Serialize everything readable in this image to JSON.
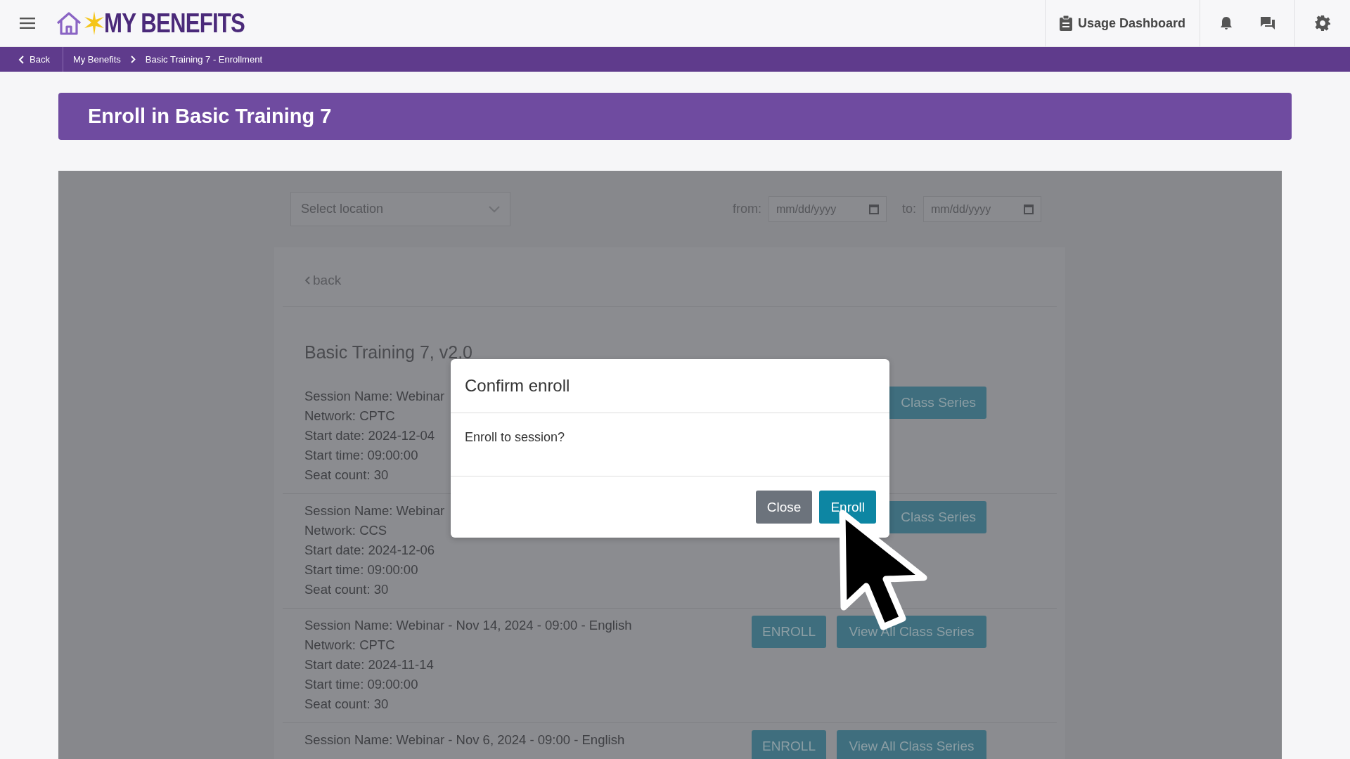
{
  "header": {
    "logo_text": "MY BENEFITS",
    "usage_button": "Usage Dashboard"
  },
  "breadcrumb": {
    "back": "Back",
    "items": [
      "My Benefits",
      "Basic Training 7 - Enrollment"
    ]
  },
  "page_title": "Enroll in Basic Training 7",
  "filters": {
    "location_placeholder": "Select location",
    "from_label": "from:",
    "from_placeholder": "mm/dd/yyyy",
    "to_label": "to:",
    "to_placeholder": "mm/dd/yyyy"
  },
  "back_link": "back",
  "course_title": "Basic Training 7, v2.0",
  "sessions": [
    {
      "lines": [
        "Session Name: Webinar",
        "Network: CPTC",
        "Start date: 2024-12-04",
        "Start time: 09:00:00",
        "Seat count: 30"
      ],
      "view_button": "Class Series"
    },
    {
      "lines": [
        "Session Name: Webinar",
        "Network: CCS",
        "Start date: 2024-12-06",
        "Start time: 09:00:00",
        "Seat count: 30"
      ],
      "view_button": "Class Series"
    },
    {
      "lines": [
        "Session Name: Webinar - Nov 14, 2024 - 09:00 - English",
        "Network: CPTC",
        "Start date: 2024-11-14",
        "Start time: 09:00:00",
        "Seat count: 30"
      ],
      "enroll_button": "ENROLL",
      "view_button": "View All Class Series"
    },
    {
      "lines": [
        "Session Name: Webinar - Nov 6, 2024 - 09:00 - English"
      ],
      "enroll_button": "ENROLL",
      "view_button": "View All Class Series"
    }
  ],
  "modal": {
    "title": "Confirm enroll",
    "message": "Enroll to session?",
    "buttons": [
      {
        "label": "Close",
        "kind": "secondary"
      },
      {
        "label": "Enroll",
        "kind": "primary"
      }
    ]
  }
}
